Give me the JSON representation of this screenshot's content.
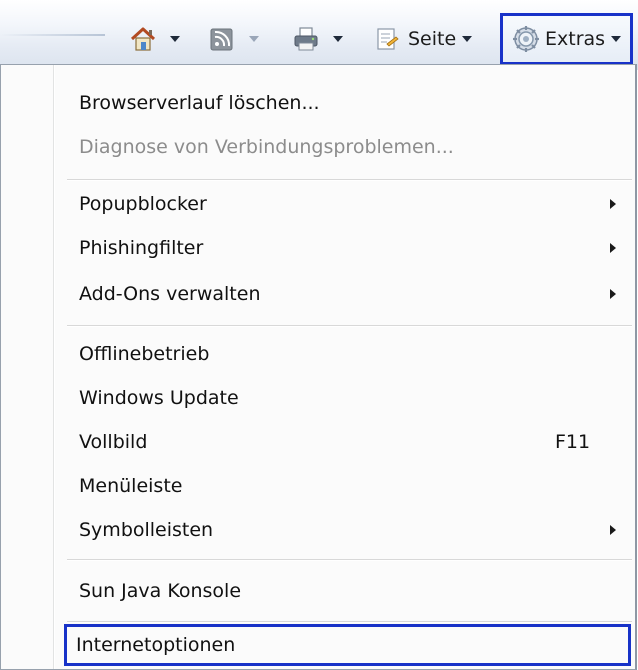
{
  "toolbar": {
    "page_label": "Seite",
    "extras_label": "Extras"
  },
  "menu": {
    "items": [
      {
        "label": "Browserverlauf löschen..."
      },
      {
        "label": "Diagnose von Verbindungsproblemen..."
      },
      {
        "label": "Popupblocker"
      },
      {
        "label": "Phishingfilter"
      },
      {
        "label": "Add-Ons verwalten"
      },
      {
        "label": "Offlinebetrieb"
      },
      {
        "label": "Windows Update"
      },
      {
        "label": "Vollbild",
        "shortcut": "F11"
      },
      {
        "label": "Menüleiste"
      },
      {
        "label": "Symbolleisten"
      },
      {
        "label": "Sun Java Konsole"
      },
      {
        "label": "Internetoptionen"
      }
    ]
  },
  "colors": {
    "highlight_border": "#1832c8",
    "disabled_text": "#8c8c8c"
  },
  "icons": [
    "home-icon",
    "feeds-icon",
    "print-icon",
    "page-icon",
    "gear-icon"
  ]
}
